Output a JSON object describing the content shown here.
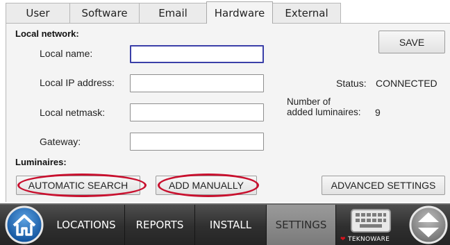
{
  "tabs": [
    {
      "label": "User"
    },
    {
      "label": "Software"
    },
    {
      "label": "Email"
    },
    {
      "label": "Hardware",
      "active": true
    },
    {
      "label": "External"
    }
  ],
  "local_network": {
    "title": "Local network:",
    "fields": [
      {
        "label": "Local name:",
        "value": ""
      },
      {
        "label": "Local IP address:",
        "value": ""
      },
      {
        "label": "Local netmask:",
        "value": ""
      },
      {
        "label": "Gateway:",
        "value": ""
      }
    ]
  },
  "save_label": "SAVE",
  "status": {
    "label": "Status:",
    "value": "CONNECTED"
  },
  "luminaires_count": {
    "label": "Number of\nadded luminaires:",
    "value": "9"
  },
  "luminaires": {
    "title": "Luminaires:",
    "automatic_search": "AUTOMATIC SEARCH",
    "add_manually": "ADD MANUALLY",
    "advanced_settings": "ADVANCED SETTINGS"
  },
  "nav": {
    "locations": "LOCATIONS",
    "reports": "REPORTS",
    "install": "INSTALL",
    "settings": "SETTINGS",
    "brand": "TEKNOWARE",
    "active": "SETTINGS"
  },
  "icons": [
    "home-icon",
    "keyboard-icon",
    "scroll-up-down-icon",
    "brand-logo-icon"
  ],
  "colors": {
    "highlight_ring": "#c8102e",
    "focus_border": "#3a3fa8",
    "nav_bg": "#2f2f2f"
  }
}
